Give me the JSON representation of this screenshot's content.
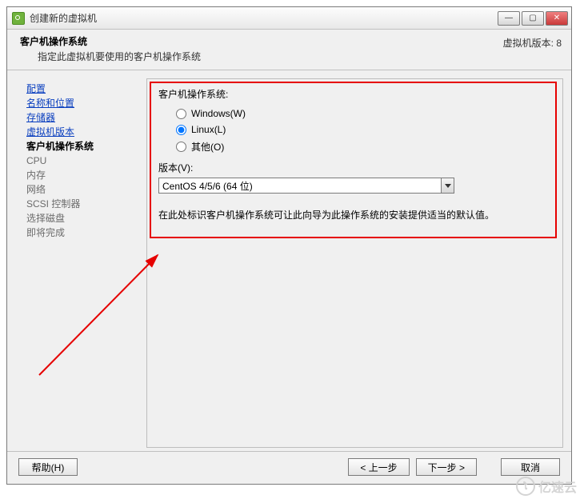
{
  "title": "创建新的虚拟机",
  "header": {
    "h1": "客户机操作系统",
    "sub": "指定此虚拟机要使用的客户机操作系统",
    "right": "虚拟机版本: 8"
  },
  "sidebar": {
    "items": [
      {
        "label": "配置",
        "kind": "link"
      },
      {
        "label": "名称和位置",
        "kind": "link"
      },
      {
        "label": "存储器",
        "kind": "link"
      },
      {
        "label": "虚拟机版本",
        "kind": "link"
      },
      {
        "label": "客户机操作系统",
        "kind": "current"
      },
      {
        "label": "CPU",
        "kind": "disabled"
      },
      {
        "label": "内存",
        "kind": "disabled"
      },
      {
        "label": "网络",
        "kind": "disabled"
      },
      {
        "label": "SCSI 控制器",
        "kind": "disabled"
      },
      {
        "label": "选择磁盘",
        "kind": "disabled"
      },
      {
        "label": "即将完成",
        "kind": "disabled"
      }
    ]
  },
  "main": {
    "group_label": "客户机操作系统:",
    "radios": [
      {
        "label": "Windows(W)",
        "checked": false
      },
      {
        "label": "Linux(L)",
        "checked": true
      },
      {
        "label": "其他(O)",
        "checked": false
      }
    ],
    "version_label": "版本(V):",
    "version_value": "CentOS 4/5/6 (64 位)",
    "hint": "在此处标识客户机操作系统可让此向导为此操作系统的安装提供适当的默认值。"
  },
  "buttons": {
    "help": "帮助(H)",
    "back": "< 上一步",
    "next": "下一步 >",
    "cancel": "取消"
  },
  "watermark": "亿速云"
}
